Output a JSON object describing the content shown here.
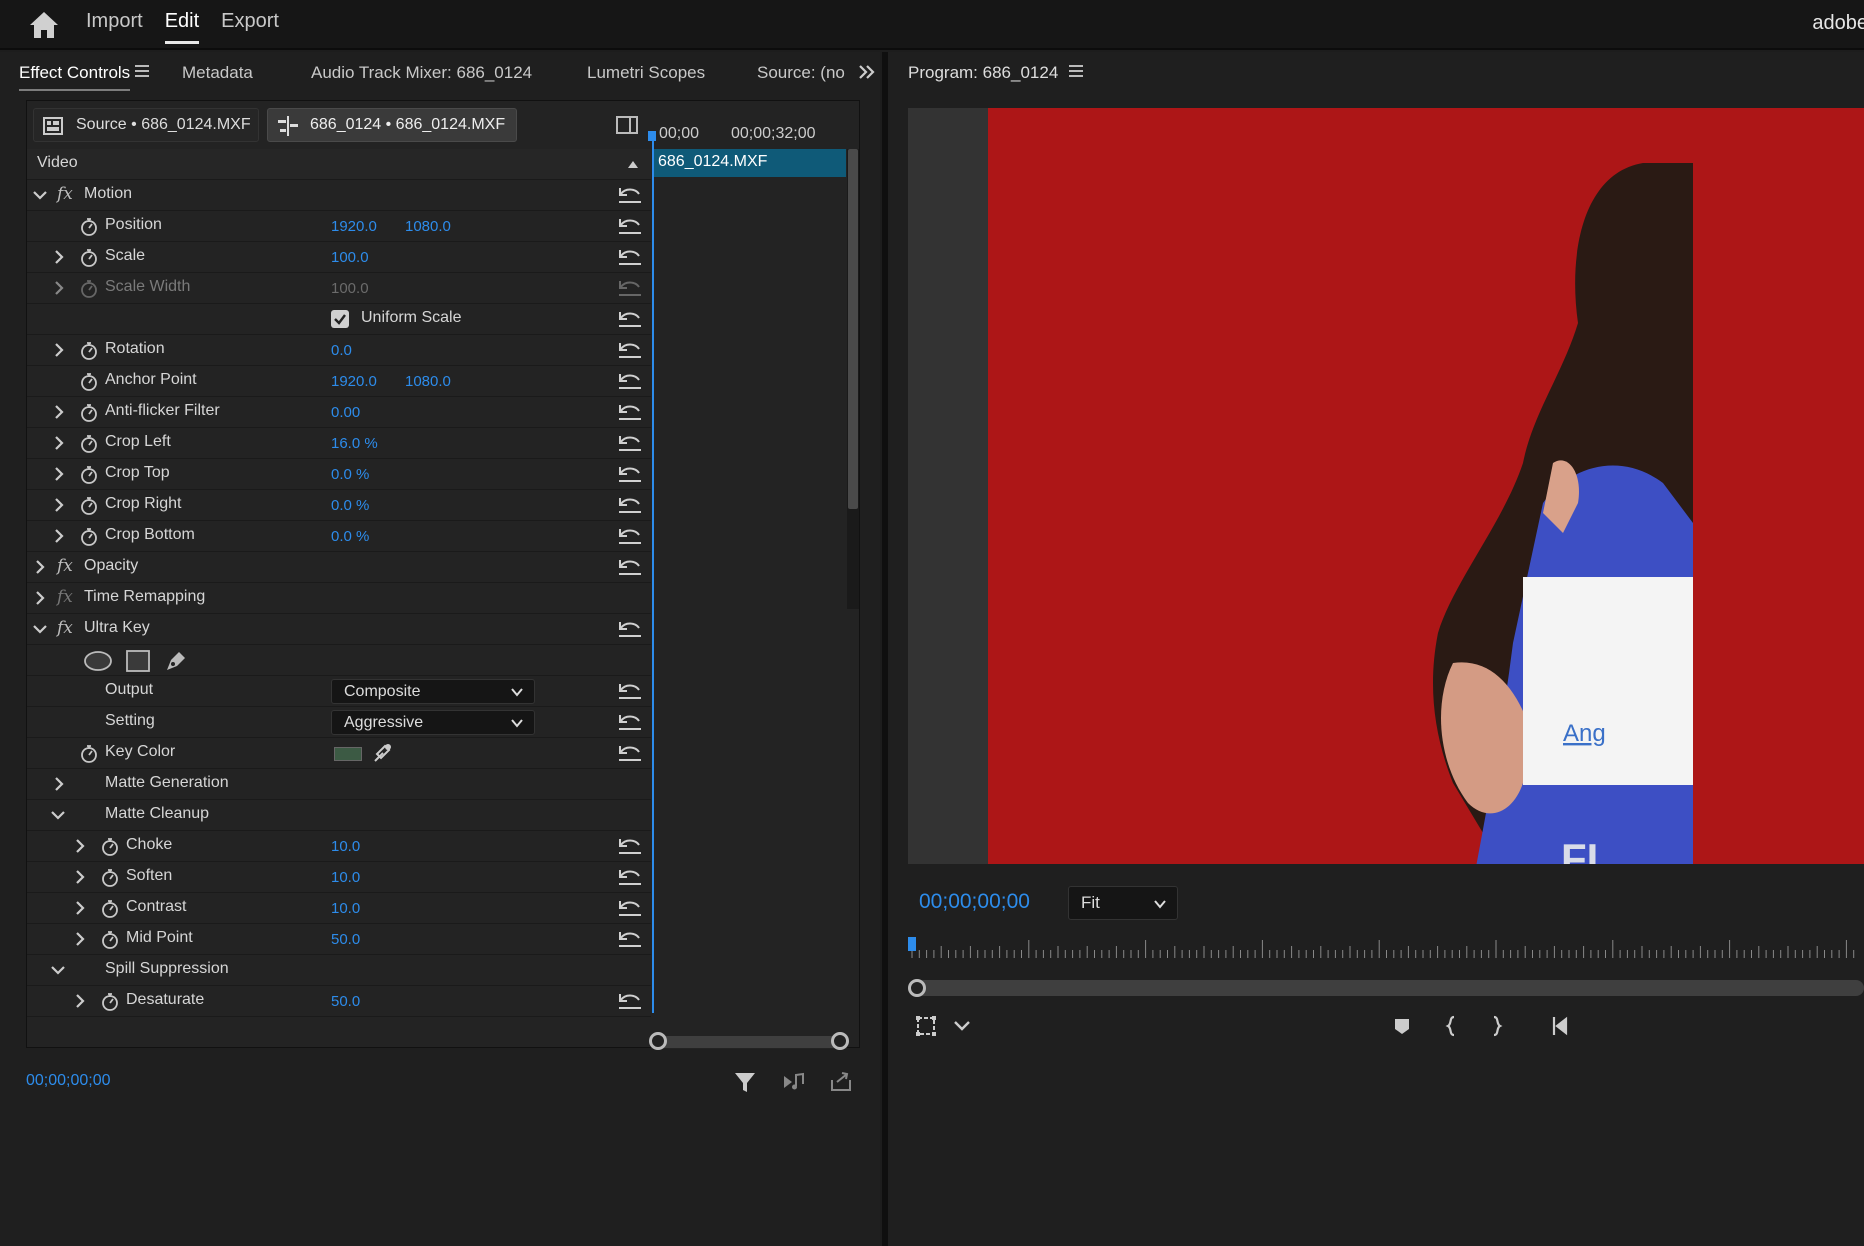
{
  "topbar": {
    "nav": [
      "Import",
      "Edit",
      "Export"
    ],
    "active_index": 1,
    "brand": "adobe"
  },
  "left_panel": {
    "tabs": [
      "Effect Controls",
      "Metadata",
      "Audio Track Mixer: 686_0124",
      "Lumetri Scopes",
      "Source: (no c"
    ],
    "active_tab": 0
  },
  "effect_controls": {
    "source_chip": "Source • 686_0124.MXF",
    "sequence_chip": "686_0124 • 686_0124.MXF",
    "section": "Video",
    "rows": [
      {
        "type": "effect",
        "label": "Motion",
        "expanded": true
      },
      {
        "type": "prop",
        "label": "Position",
        "v1": "1920.0",
        "v2": "1080.0"
      },
      {
        "type": "prop",
        "label": "Scale",
        "v1": "100.0",
        "expand": true
      },
      {
        "type": "prop",
        "label": "Scale Width",
        "v1": "100.0",
        "expand": true,
        "dim": true
      },
      {
        "type": "check",
        "label": "Uniform Scale"
      },
      {
        "type": "prop",
        "label": "Rotation",
        "v1": "0.0",
        "expand": true
      },
      {
        "type": "prop",
        "label": "Anchor Point",
        "v1": "1920.0",
        "v2": "1080.0"
      },
      {
        "type": "prop",
        "label": "Anti-flicker Filter",
        "v1": "0.00",
        "expand": true
      },
      {
        "type": "prop",
        "label": "Crop Left",
        "v1": "16.0 %",
        "expand": true
      },
      {
        "type": "prop",
        "label": "Crop Top",
        "v1": "0.0 %",
        "expand": true
      },
      {
        "type": "prop",
        "label": "Crop Right",
        "v1": "0.0 %",
        "expand": true
      },
      {
        "type": "prop",
        "label": "Crop Bottom",
        "v1": "0.0 %",
        "expand": true
      },
      {
        "type": "effect",
        "label": "Opacity",
        "expanded": false
      },
      {
        "type": "effect",
        "label": "Time Remapping",
        "expanded": false,
        "dim": true
      },
      {
        "type": "effect",
        "label": "Ultra Key",
        "expanded": true
      },
      {
        "type": "masks"
      },
      {
        "type": "dropdown",
        "label": "Output",
        "value": "Composite"
      },
      {
        "type": "dropdown",
        "label": "Setting",
        "value": "Aggressive"
      },
      {
        "type": "color",
        "label": "Key Color"
      },
      {
        "type": "group",
        "label": "Matte Generation",
        "expanded": false
      },
      {
        "type": "group",
        "label": "Matte Cleanup",
        "expanded": true
      },
      {
        "type": "subprop",
        "label": "Choke",
        "v1": "10.0"
      },
      {
        "type": "subprop",
        "label": "Soften",
        "v1": "10.0"
      },
      {
        "type": "subprop",
        "label": "Contrast",
        "v1": "10.0"
      },
      {
        "type": "subprop",
        "label": "Mid Point",
        "v1": "50.0"
      },
      {
        "type": "group",
        "label": "Spill Suppression",
        "expanded": true
      },
      {
        "type": "subprop",
        "label": "Desaturate",
        "v1": "50.0"
      }
    ],
    "timeline": {
      "t1": "00;00",
      "t2": "00;00;32;00",
      "clip": "686_0124.MXF"
    },
    "timecode": "00;00;00;00"
  },
  "program": {
    "title": "Program: 686_0124",
    "timecode": "00;00;00;00",
    "zoom": "Fit",
    "card_text": "Ang",
    "shirt_text": "FL"
  },
  "colors": {
    "accent": "#2d8ceb",
    "frame_red": "#ad1617",
    "clip": "#0f5a78"
  }
}
